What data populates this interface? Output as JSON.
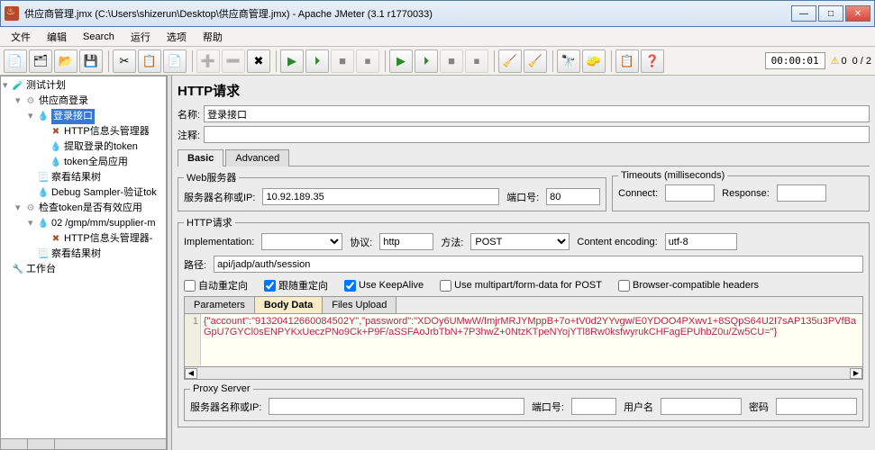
{
  "window": {
    "title": "供应商管理.jmx (C:\\Users\\shizerun\\Desktop\\供应商管理.jmx) - Apache JMeter (3.1 r1770033)"
  },
  "menus": [
    "文件",
    "编辑",
    "Search",
    "运行",
    "选项",
    "帮助"
  ],
  "timer": "00:00:01",
  "warn_count": "0",
  "thread_count": "0 / 2",
  "tree": {
    "root": "测试计划",
    "n1": "供应商登录",
    "n2": "登录接口",
    "n3": "HTTP信息头管理器",
    "n4": "提取登录的token",
    "n5": "token全局应用",
    "n6": "察看结果树",
    "n7": "Debug Sampler-验证tok",
    "n8": "检查token是否有效应用",
    "n9": "02 /gmp/mm/supplier-m",
    "n10": "HTTP信息头管理器-",
    "n11": "察看结果树",
    "n12": "工作台"
  },
  "panel": {
    "title": "HTTP请求",
    "name_label": "名称:",
    "name_value": "登录接口",
    "comment_label": "注释:",
    "comment_value": "",
    "tabs": {
      "basic": "Basic",
      "advanced": "Advanced"
    },
    "webserver_legend": "Web服务器",
    "server_label": "服务器名称或IP:",
    "server_value": "10.92.189.35",
    "port_label": "端口号:",
    "port_value": "80",
    "timeouts_legend": "Timeouts (milliseconds)",
    "connect_label": "Connect:",
    "connect_value": "",
    "response_label": "Response:",
    "response_value": "",
    "httpreq_legend": "HTTP请求",
    "impl_label": "Implementation:",
    "impl_value": "",
    "proto_label": "协议:",
    "proto_value": "http",
    "method_label": "方法:",
    "method_value": "POST",
    "enc_label": "Content encoding:",
    "enc_value": "utf-8",
    "path_label": "路径:",
    "path_value": "api/jadp/auth/session",
    "chk_redirect_auto": "自动重定向",
    "chk_redirect_follow": "跟随重定向",
    "chk_keepalive": "Use KeepAlive",
    "chk_multipart": "Use multipart/form-data for POST",
    "chk_browser": "Browser-compatible headers",
    "subtabs": {
      "params": "Parameters",
      "body": "Body Data",
      "files": "Files Upload"
    },
    "body_line": "1",
    "body_text": "{\"account\":\"91320412660084502Y\",\"password\":\"XDOy6UMwW/ImjrMRJYMppB+7o+tV0d2YYvgw/E0YDOO4PXwv1+8SQpS64U2I7sAP135u3PVfBaGpU7GYCl0sENPYKxUeczPNo9Ck+P9F/aSSFAoJrbTbN+7P3hwZ+0NtzKTpeNYojYTl8Rw0ksfwyrukCHFagEPUhbZ0u/Zw5CU=\"}",
    "proxy_legend": "Proxy Server",
    "proxy_server_label": "服务器名称或IP:",
    "proxy_port_label": "端口号:",
    "proxy_user_label": "用户名",
    "proxy_pass_label": "密码"
  }
}
